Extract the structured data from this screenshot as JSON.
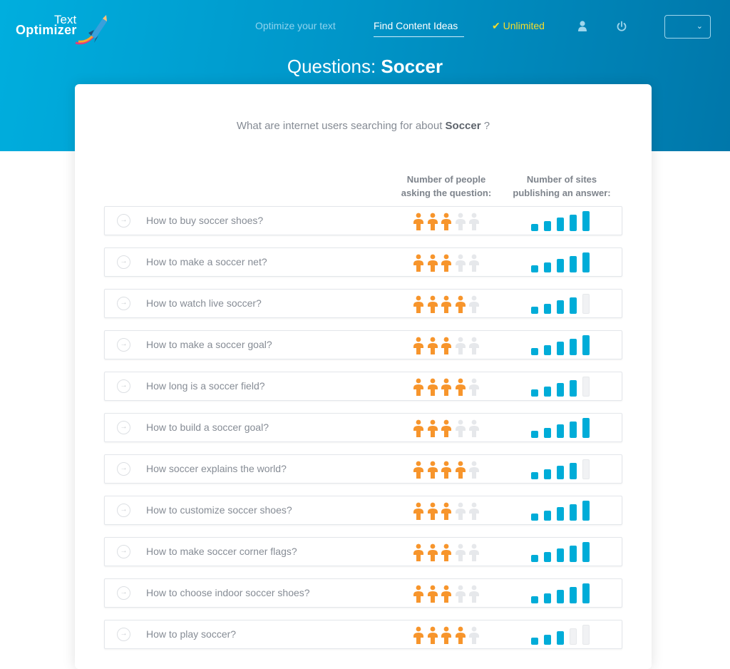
{
  "header": {
    "logo_line1": "Text",
    "logo_line2": "Optimizer",
    "nav": {
      "optimize": "Optimize your text",
      "find_ideas": "Find Content Ideas",
      "unlimited": "✔ Unlimited"
    },
    "language_select_value": "",
    "language_select_chevron": "⌄"
  },
  "page": {
    "title_prefix": "Questions: ",
    "title_topic": "Soccer",
    "subtitle_prefix": "What are internet users searching for about ",
    "subtitle_topic": "Soccer",
    "subtitle_suffix": " ?"
  },
  "columns": {
    "people_line1": "Number of people",
    "people_line2": "asking the question:",
    "sites_line1": "Number of sites",
    "sites_line2": "publishing an answer:"
  },
  "scale_max": 5,
  "colors": {
    "people_active": "#f7952c",
    "people_inactive": "#e6e8eb",
    "sites_active": "#00acd8",
    "sites_inactive": "#e6e8eb"
  },
  "questions": [
    {
      "text": "How to buy soccer shoes?",
      "people": 3,
      "sites": 5
    },
    {
      "text": "How to make a soccer net?",
      "people": 3,
      "sites": 5
    },
    {
      "text": "How to watch live soccer?",
      "people": 4,
      "sites": 4
    },
    {
      "text": "How to make a soccer goal?",
      "people": 3,
      "sites": 5
    },
    {
      "text": "How long is a soccer field?",
      "people": 4,
      "sites": 4
    },
    {
      "text": "How to build a soccer goal?",
      "people": 3,
      "sites": 5
    },
    {
      "text": "How soccer explains the world?",
      "people": 4,
      "sites": 4
    },
    {
      "text": "How to customize soccer shoes?",
      "people": 3,
      "sites": 5
    },
    {
      "text": "How to make soccer corner flags?",
      "people": 3,
      "sites": 5
    },
    {
      "text": "How to choose indoor soccer shoes?",
      "people": 3,
      "sites": 5
    },
    {
      "text": "How to play soccer?",
      "people": 4,
      "sites": 3
    }
  ]
}
